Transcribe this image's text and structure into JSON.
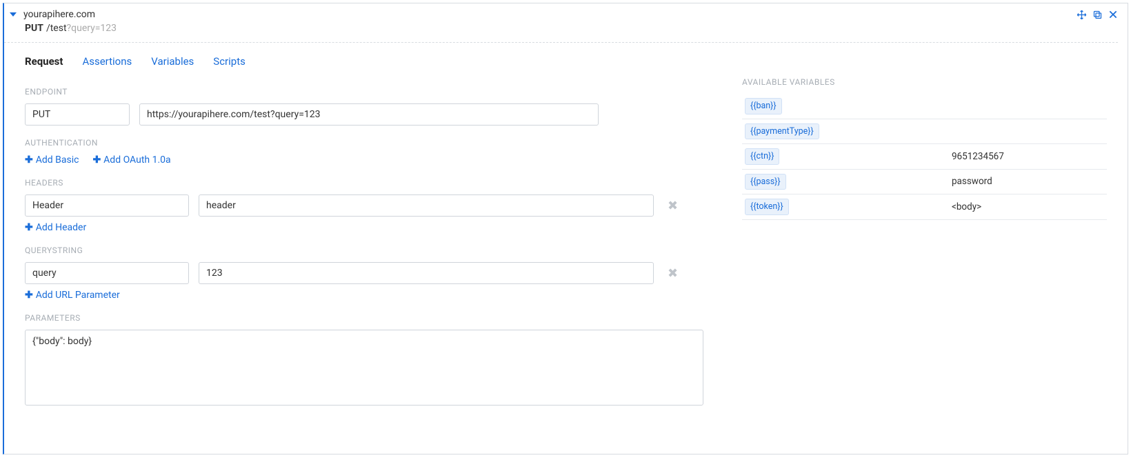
{
  "header": {
    "title": "yourapihere.com",
    "method": "PUT",
    "path": "/test",
    "query": "?query=123"
  },
  "tabs": [
    {
      "label": "Request",
      "active": true
    },
    {
      "label": "Assertions",
      "active": false
    },
    {
      "label": "Variables",
      "active": false
    },
    {
      "label": "Scripts",
      "active": false
    }
  ],
  "sections": {
    "endpoint": "ENDPOINT",
    "authentication": "AUTHENTICATION",
    "headers": "HEADERS",
    "querystring": "QUERYSTRING",
    "parameters": "PARAMETERS",
    "available_vars": "AVAILABLE VARIABLES"
  },
  "endpoint": {
    "method": "PUT",
    "url": "https://yourapihere.com/test?query=123"
  },
  "auth": {
    "add_basic": "Add Basic",
    "add_oauth": "Add OAuth 1.0a"
  },
  "headers": {
    "rows": [
      {
        "key": "Header",
        "value": "header"
      }
    ],
    "add_label": "Add Header"
  },
  "querystring": {
    "rows": [
      {
        "key": "query",
        "value": "123"
      }
    ],
    "add_label": "Add URL Parameter"
  },
  "parameters": {
    "body": "{\"body\": body}"
  },
  "variables": [
    {
      "name": "{{ban}}",
      "value": ""
    },
    {
      "name": "{{paymentType}}",
      "value": ""
    },
    {
      "name": "{{ctn}}",
      "value": "9651234567"
    },
    {
      "name": "{{pass}}",
      "value": "password"
    },
    {
      "name": "{{token}}",
      "value": "<body>"
    }
  ]
}
